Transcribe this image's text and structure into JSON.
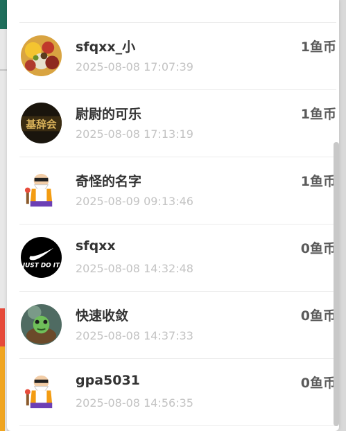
{
  "ranking": {
    "currency_unit": "鱼币",
    "rows": [
      {
        "name": "sfqxx_小",
        "time": "2025-08-08 17:07:39",
        "coins": "1鱼币",
        "avatar": "fruit-salad-avatar"
      },
      {
        "name": "尉尉的可乐",
        "time": "2025-08-08 17:13:19",
        "coins": "1鱼币",
        "avatar": "golden-sign-avatar",
        "avatar_text": "基辞会"
      },
      {
        "name": "奇怪的名字",
        "time": "2025-08-09 09:13:46",
        "coins": "1鱼币",
        "avatar": "old-master-avatar"
      },
      {
        "name": "sfqxx",
        "time": "2025-08-08 14:32:48",
        "coins": "0鱼币",
        "avatar": "swoosh-logo-avatar",
        "avatar_text": "JUST DO IT"
      },
      {
        "name": "快速收敛",
        "time": "2025-08-08 14:37:33",
        "coins": "0鱼币",
        "avatar": "turtle-avatar"
      },
      {
        "name": "gpa5031",
        "time": "2025-08-08 14:56:35",
        "coins": "0鱼币",
        "avatar": "old-master-avatar"
      }
    ]
  },
  "colors": {
    "name": "#333333",
    "time": "#c3c3c3",
    "coins": "#5a5a5a",
    "divider": "#ececec",
    "scrollbar": "#c8c8c8"
  }
}
